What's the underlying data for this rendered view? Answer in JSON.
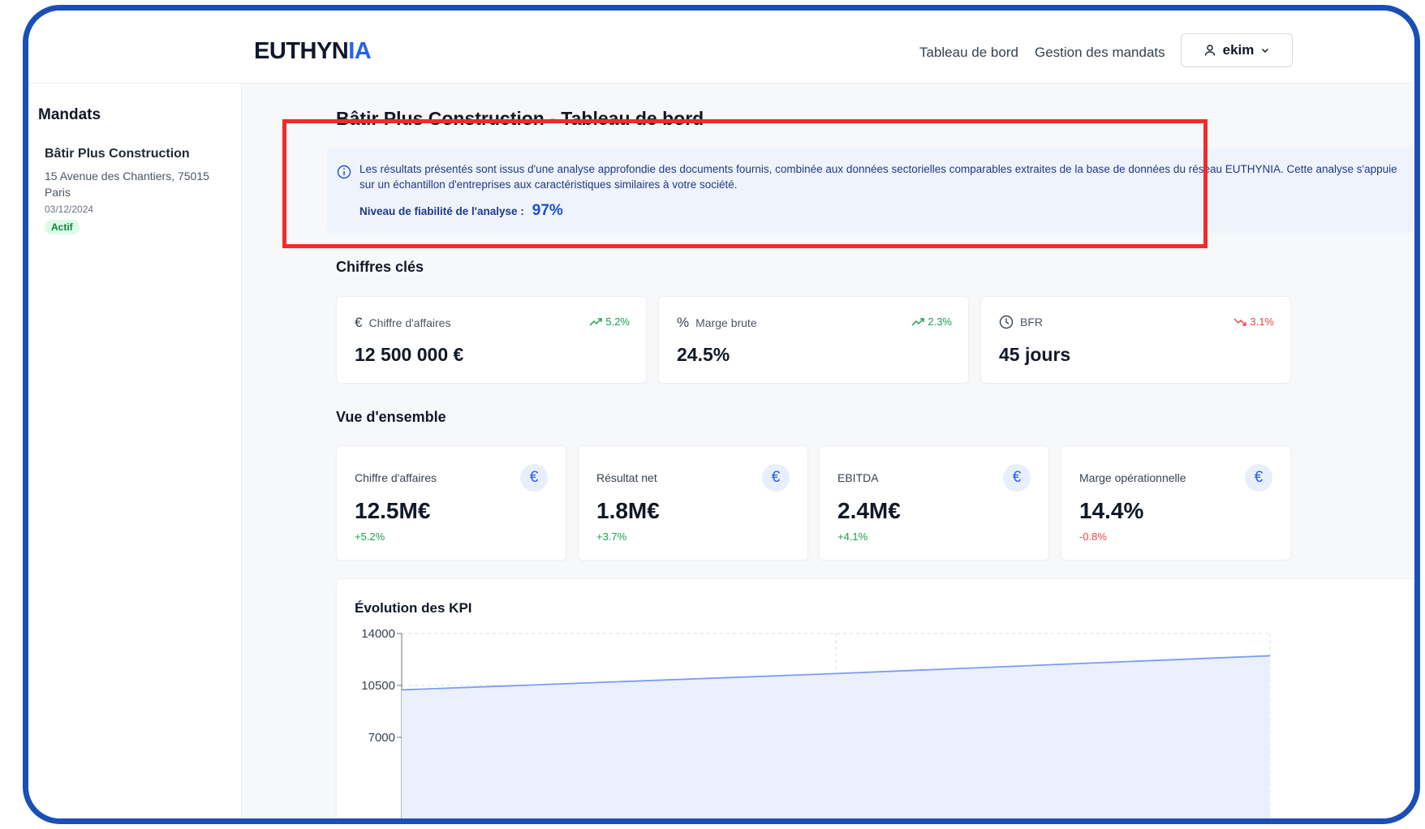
{
  "header": {
    "logo_main": "EUTHYN",
    "logo_accent": "IA",
    "nav": [
      "Tableau de bord",
      "Gestion des mandats"
    ],
    "user": "ekim"
  },
  "sidebar": {
    "title": "Mandats",
    "items": [
      {
        "name": "Bâtir Plus Construction",
        "address": "15 Avenue des Chantiers, 75015 Paris",
        "date": "03/12/2024",
        "status": "Actif"
      }
    ]
  },
  "main": {
    "title": "Bâtir Plus Construction - Tableau de bord",
    "info": {
      "text": "Les résultats présentés sont issus d'une analyse approfondie des documents fournis, combinée aux données sectorielles comparables extraites de la base de données du réseau EUTHYNIA. Cette analyse s'appuie sur un échantillon d'entreprises aux caractéristiques similaires à votre société.",
      "reliability_label": "Niveau de fiabilité de l'analyse :",
      "reliability_value": "97%"
    },
    "key_figures_title": "Chiffres clés",
    "key_figures": [
      {
        "icon": "euro-icon",
        "label": "Chiffre d'affaires",
        "value": "12 500 000 €",
        "delta": "5.2%",
        "trend": "up"
      },
      {
        "icon": "percent-icon",
        "label": "Marge brute",
        "value": "24.5%",
        "delta": "2.3%",
        "trend": "up"
      },
      {
        "icon": "clock-icon",
        "label": "BFR",
        "value": "45 jours",
        "delta": "3.1%",
        "trend": "down"
      }
    ],
    "overview_title": "Vue d'ensemble",
    "overview": [
      {
        "label": "Chiffre d'affaires",
        "value": "12.5M€",
        "delta": "+5.2%",
        "trend": "up"
      },
      {
        "label": "Résultat net",
        "value": "1.8M€",
        "delta": "+3.7%",
        "trend": "up"
      },
      {
        "label": "EBITDA",
        "value": "2.4M€",
        "delta": "+4.1%",
        "trend": "up"
      },
      {
        "label": "Marge opérationnelle",
        "value": "14.4%",
        "delta": "-0.8%",
        "trend": "down"
      }
    ],
    "overview_icon_glyph": "€"
  },
  "colors": {
    "brand": "#2563eb",
    "frame": "#1b4fb8",
    "highlight": "#ef2b2b",
    "up": "#16a34a",
    "down": "#ef4444"
  },
  "chart_data": {
    "type": "area",
    "title": "Évolution des KPI",
    "y_ticks": [
      14000,
      10500,
      7000
    ],
    "ylim": [
      7000,
      14000
    ],
    "grid": true,
    "series": [
      {
        "values": [
          10200,
          11300,
          12500
        ]
      }
    ]
  }
}
